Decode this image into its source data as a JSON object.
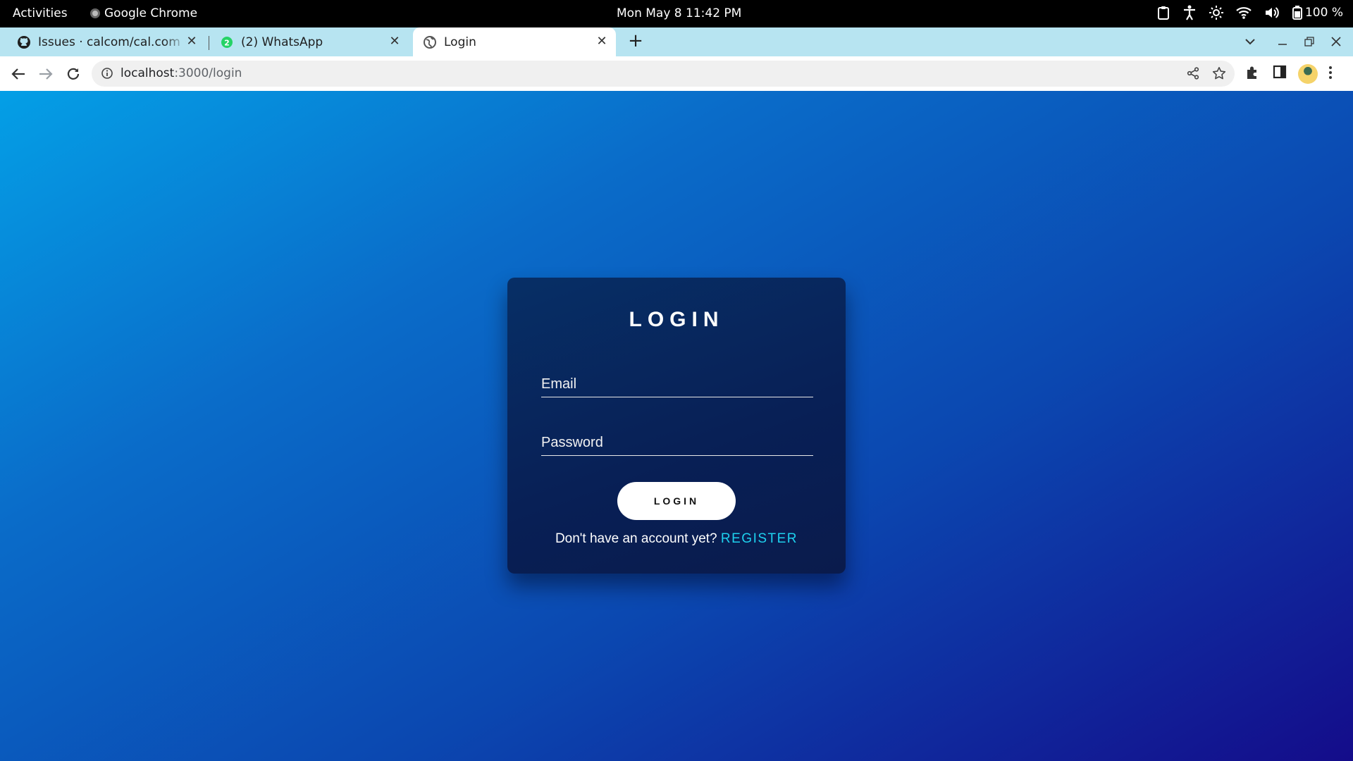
{
  "system": {
    "activities_label": "Activities",
    "app_name": "Google Chrome",
    "clock": "Mon May 8  11:42 PM",
    "battery": "100 %"
  },
  "browser": {
    "tabs": [
      {
        "title": "Issues · calcom/cal.com · G",
        "icon": "github-icon"
      },
      {
        "title": "(2) WhatsApp",
        "icon": "whatsapp-icon",
        "badge": "2"
      },
      {
        "title": "Login",
        "icon": "globe-icon",
        "active": true
      }
    ],
    "url_host": "localhost",
    "url_path": ":3000/login"
  },
  "page": {
    "title": "LOGIN",
    "email_placeholder": "Email",
    "password_placeholder": "Password",
    "login_button": "LOGIN",
    "register_prompt": "Don't have an account yet?",
    "register_link": "REGISTER"
  },
  "colors": {
    "accent": "#1ed1ee",
    "card_bg": "#081f55",
    "tabstrip_bg": "#b7e4f1"
  }
}
